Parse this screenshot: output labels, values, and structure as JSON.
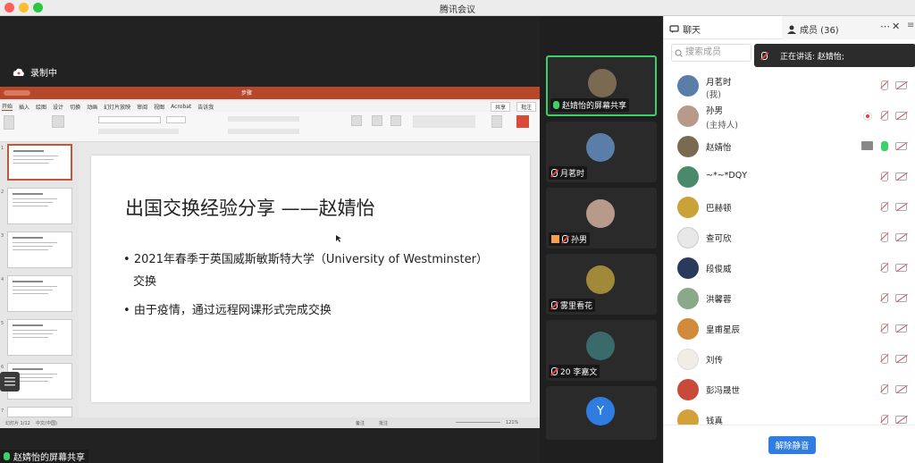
{
  "app": {
    "title": "腾讯会议"
  },
  "recording": {
    "label": "录制中"
  },
  "ppt": {
    "doc_title": "步骤",
    "tabs": [
      "开始",
      "插入",
      "绘图",
      "设计",
      "切换",
      "动画",
      "幻灯片放映",
      "审阅",
      "视图",
      "Acrobat",
      "告诉我"
    ],
    "share_label": "共享",
    "comment_label": "批注",
    "status_left": "幻灯片 1/12",
    "status_lang": "中文(中国)",
    "status_notes": "备注",
    "status_comments": "批注",
    "zoom": "121%",
    "thumb_numbers": [
      "1",
      "2",
      "3",
      "4",
      "5",
      "6",
      "7"
    ],
    "slide": {
      "title": "出国交换经验分享 ——赵婧怡",
      "bullets": [
        "2021年春季于英国威斯敏斯特大学（University of Westminster）",
        "交换",
        "由于疫情，通过远程网课形式完成交换"
      ]
    }
  },
  "sharer": {
    "label": "赵婧怡的屏幕共享"
  },
  "videos": [
    {
      "name": "赵婧怡的屏幕共享",
      "active": true,
      "color": "#7a6a52"
    },
    {
      "name": "月茗时",
      "active": false,
      "color": "#5a7ea8"
    },
    {
      "name": "孙男",
      "active": false,
      "color": "#b89a8a"
    },
    {
      "name": "雾里看花",
      "active": false,
      "color": "#a08a3a"
    },
    {
      "name": "20 李嘉文",
      "active": false,
      "color": "#3a6a6a"
    },
    {
      "name": "",
      "active": false,
      "initial": "Y",
      "color": "#2f7de1"
    }
  ],
  "panel": {
    "chat_tab": "聊天",
    "members_tab": "成员 (36)",
    "search_placeholder": "搜索成员",
    "speaking": "正在讲话: 赵婧怡;",
    "unmute": "解除静音",
    "members": [
      {
        "name": "月茗时",
        "sub": "(我)",
        "color": "#5a7ea8"
      },
      {
        "name": "孙男",
        "sub": "(主持人)",
        "color": "#b89a8a"
      },
      {
        "name": "赵婧怡",
        "sub": "",
        "color": "#7a6a52"
      },
      {
        "name": "~*~*DQY",
        "sub": "",
        "color": "#4a8a6a"
      },
      {
        "name": "巴赫顿",
        "sub": "",
        "color": "#c9a23a"
      },
      {
        "name": "查可欣",
        "sub": "",
        "color": "#e8e8e8"
      },
      {
        "name": "段俊威",
        "sub": "",
        "color": "#2a3a5a"
      },
      {
        "name": "洪馨蓉",
        "sub": "",
        "color": "#8aa88a"
      },
      {
        "name": "皇甫星辰",
        "sub": "",
        "color": "#d08a3a"
      },
      {
        "name": "刘传",
        "sub": "",
        "color": "#f0ece6"
      },
      {
        "name": "彭冯晟世",
        "sub": "",
        "color": "#c84a3a"
      },
      {
        "name": "钱真",
        "sub": "",
        "color": "#d4a03a"
      }
    ]
  }
}
